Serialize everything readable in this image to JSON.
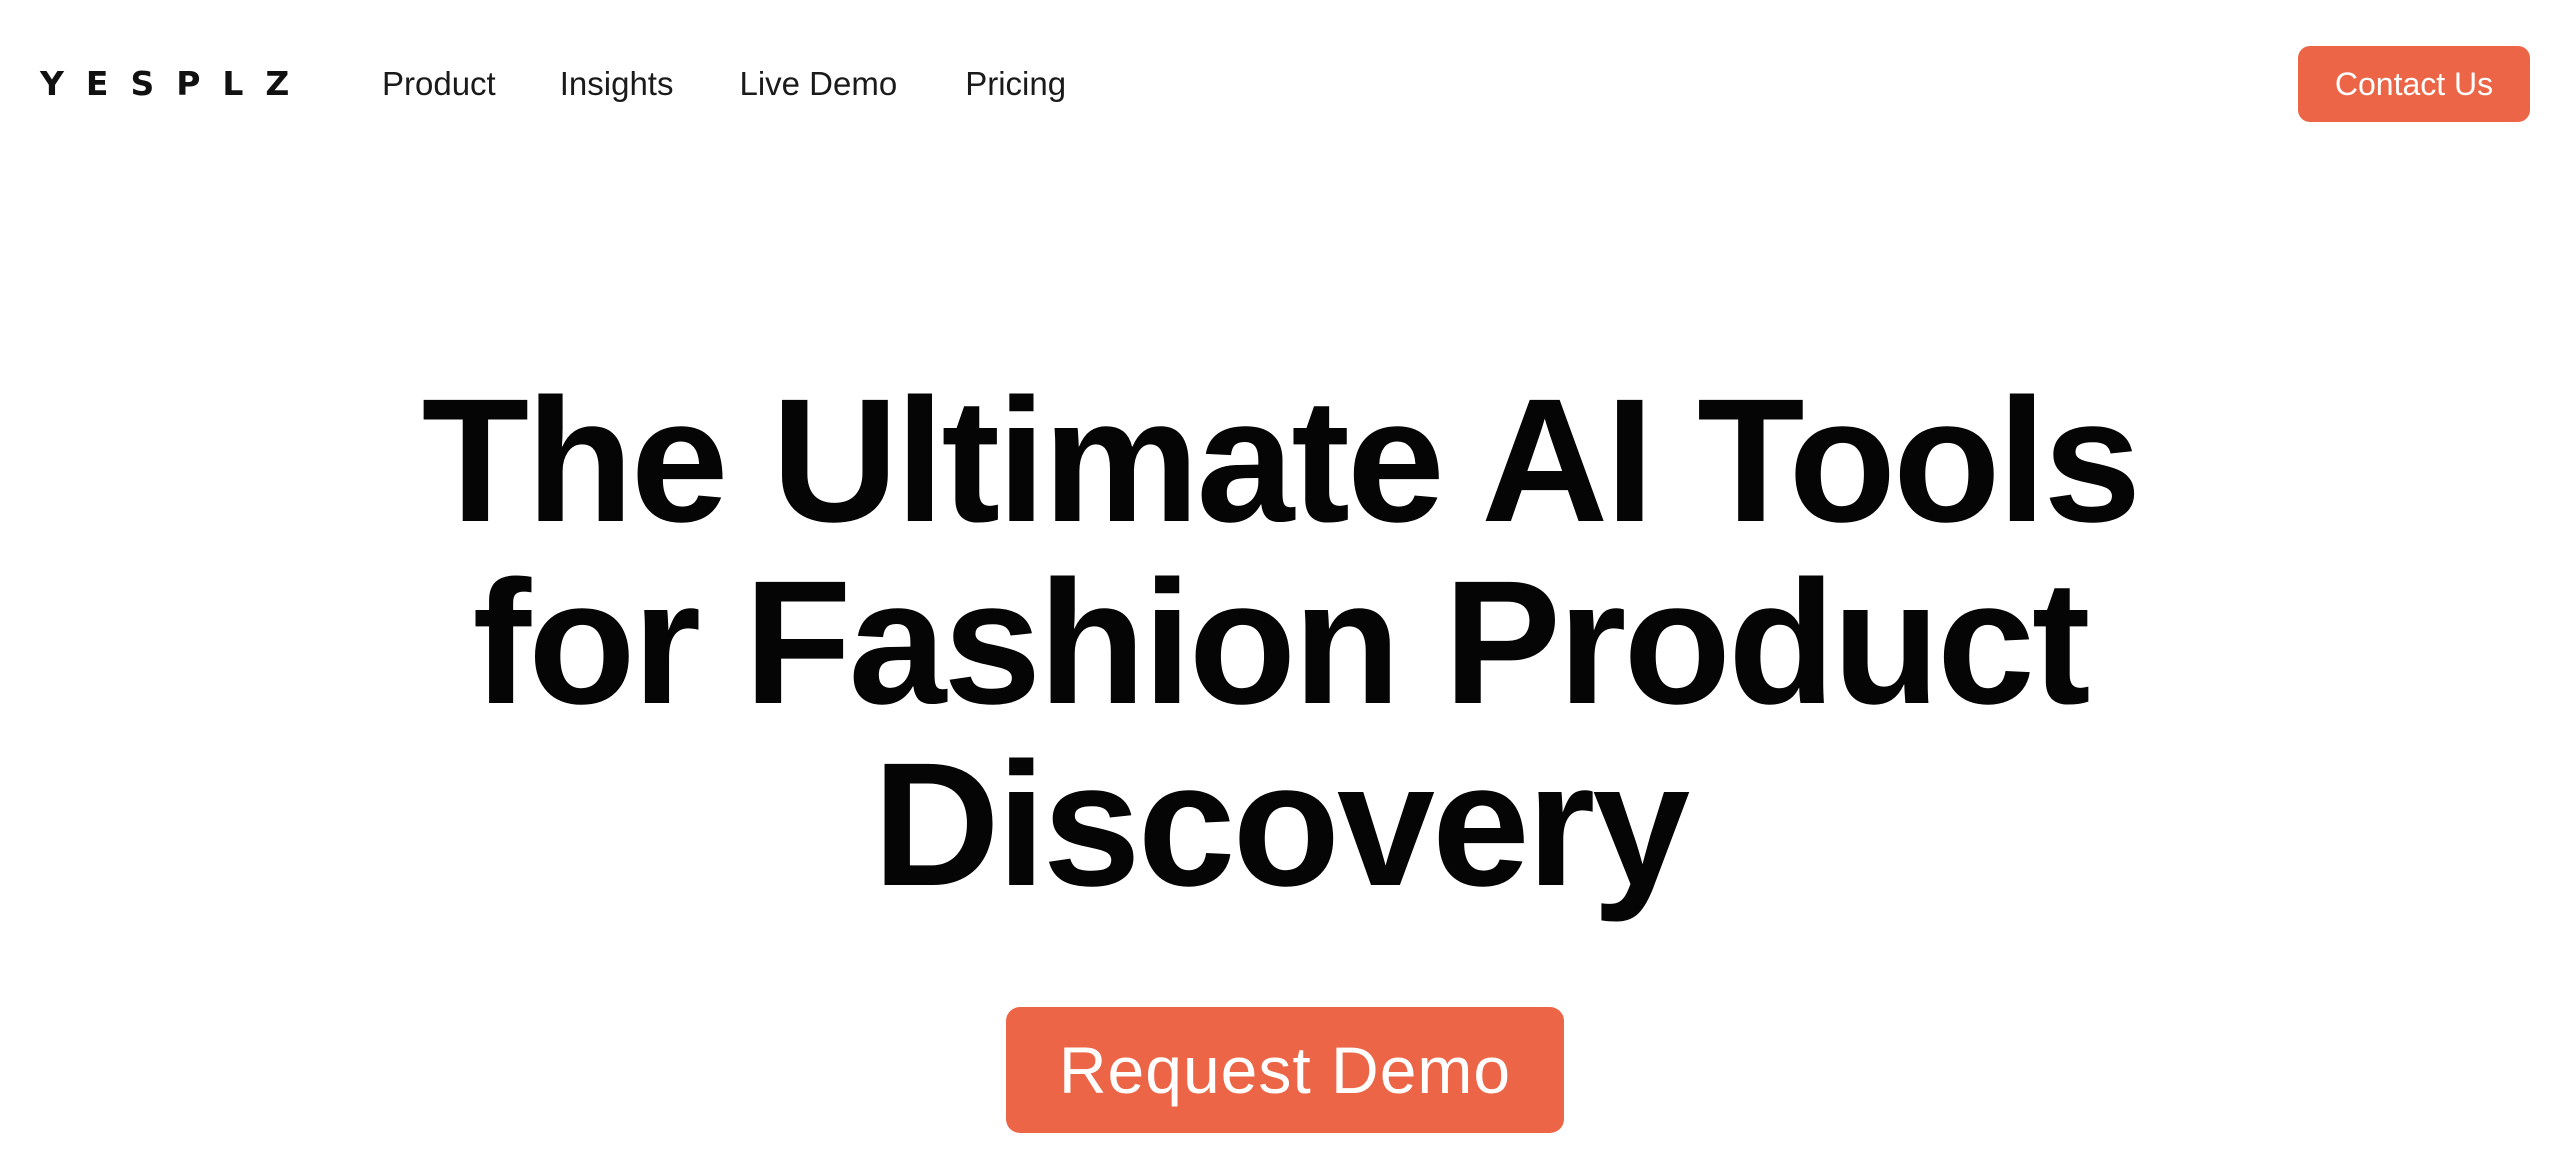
{
  "header": {
    "logo_text": "YESPLZ",
    "nav": [
      {
        "label": "Product"
      },
      {
        "label": "Insights"
      },
      {
        "label": "Live Demo"
      },
      {
        "label": "Pricing"
      }
    ],
    "contact_label": "Contact Us"
  },
  "hero": {
    "title_lines": [
      "The Ultimate AI Tools",
      "for Fashion Product",
      "Discovery"
    ],
    "cta_label": "Request Demo"
  },
  "colors": {
    "accent": "#ec6547",
    "text": "#0a0a0a",
    "background": "#ffffff"
  }
}
